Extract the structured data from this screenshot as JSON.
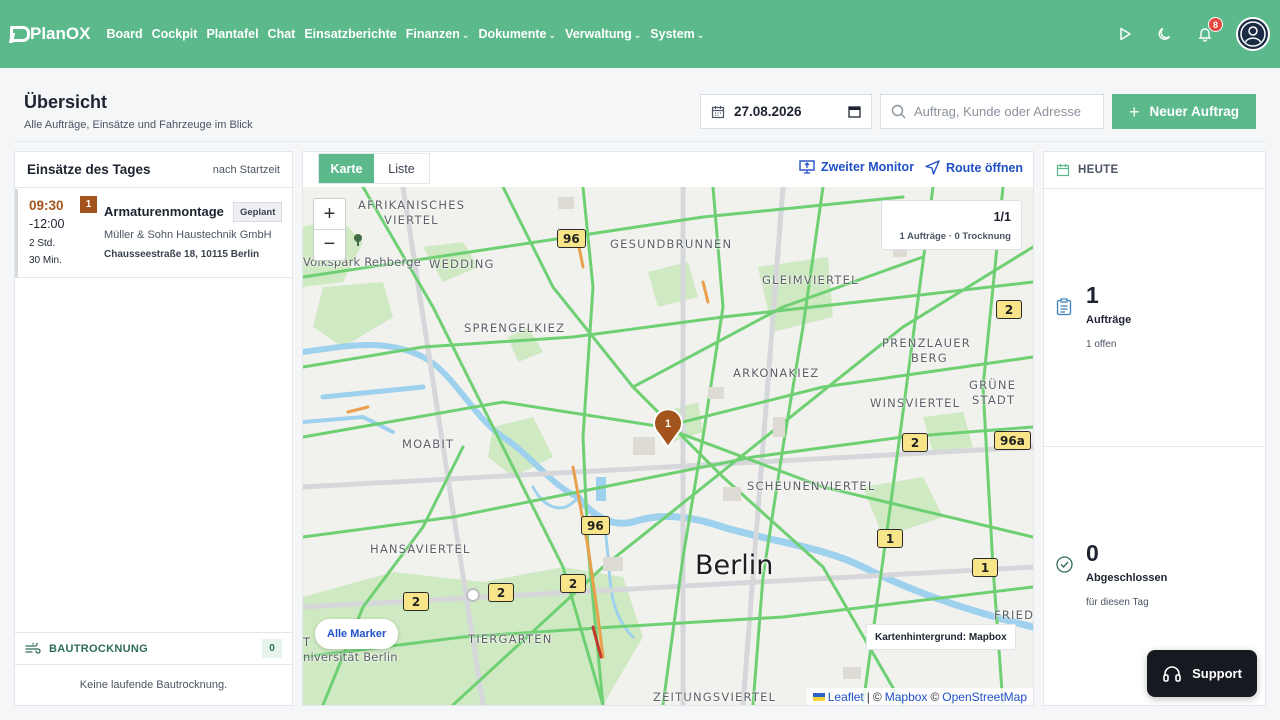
{
  "brand": {
    "name": "PlanOX",
    "color": "#5bb98c"
  },
  "nav": [
    {
      "label": "Board",
      "dropdown": false
    },
    {
      "label": "Cockpit",
      "dropdown": false,
      "active": true
    },
    {
      "label": "Plantafel",
      "dropdown": false
    },
    {
      "label": "Chat",
      "dropdown": false
    },
    {
      "label": "Einsatzberichte",
      "dropdown": false
    },
    {
      "label": "Finanzen",
      "dropdown": true
    },
    {
      "label": "Dokumente",
      "dropdown": true
    },
    {
      "label": "Verwaltung",
      "dropdown": true
    },
    {
      "label": "System",
      "dropdown": true
    }
  ],
  "topbar": {
    "notification_count": "8",
    "icons": [
      "play-icon",
      "moon-icon",
      "bell-icon",
      "user-avatar-icon"
    ]
  },
  "header": {
    "title": "Übersicht",
    "subtitle": "Alle Aufträge, Einsätze und Fahrzeuge im Blick",
    "date_value": "27.08.2026",
    "search_placeholder": "Auftrag, Kunde oder Adresse",
    "new_button": "Neuer Auftrag"
  },
  "left_panel": {
    "title": "Einsätze des Tages",
    "sort_label": "nach Startzeit",
    "jobs": [
      {
        "start": "09:30",
        "end": "-12:00",
        "duration_hours": "2 Std.",
        "duration_minutes": "30 Min.",
        "number": "1",
        "title": "Armaturenmontage",
        "status": "Geplant",
        "client": "Müller & Sohn Haustechnik GmbH",
        "address": "Chausseestraße 18, 10115 Berlin"
      }
    ],
    "bautrocknung": {
      "title": "BAUTROCKNUNG",
      "count": "0",
      "empty_text": "Keine laufende Bautrocknung."
    }
  },
  "map": {
    "tabs": [
      {
        "label": "Karte",
        "active": true
      },
      {
        "label": "Liste",
        "active": false
      }
    ],
    "actions": {
      "second_monitor": "Zweiter Monitor",
      "open_route": "Route öffnen"
    },
    "zoom_in": "+",
    "zoom_out": "−",
    "counter": {
      "ratio": "1/1",
      "detail": "1 Aufträge · 0 Trocknung"
    },
    "pin_number": "1",
    "city": "Berlin",
    "district_labels": {
      "afrikanisches": "AFRIKANISCHES",
      "viertel": "VIERTEL",
      "wedding": "WEDDING",
      "gesundbrunnen": "GESUNDBRUNNEN",
      "gleimviertel": "GLEIMVIERTEL",
      "sprengelkiez": "SPRENGELKIEZ",
      "prenzlauer": "PRENZLAUER",
      "berg": "BERG",
      "arkonakiez": "ARKONAKIEZ",
      "winsviertel": "WINSVIERTEL",
      "gruene": "GRÜNE",
      "stadt": "STADT",
      "moabit": "MOABIT",
      "scheunenviertel": "SCHEUNENVIERTEL",
      "hansaviertel": "HANSAVIERTEL",
      "tiergarten": "TIERGARTEN",
      "fried": "FRIED",
      "zeitungsviertel": "ZEITUNGSVIERTEL",
      "volkspark": "Volkspark Rehberge",
      "universitaet": "niversität Berlin",
      "t_edge": "T"
    },
    "route_badges": [
      "96",
      "2",
      "2",
      "96a",
      "96",
      "1",
      "2",
      "2",
      "1",
      "2"
    ],
    "all_markers": "Alle Marker",
    "background_label": "Kartenhintergrund: Mapbox",
    "attribution": {
      "leaflet": "Leaflet",
      "sep": "|",
      "copyright": "©",
      "mapbox": "Mapbox",
      "osm": "OpenStreetMap"
    },
    "colors": {
      "pin": "#a3541c",
      "road_green": "#67cc6b",
      "park": "#cce8c0",
      "water": "#9ed1ee"
    }
  },
  "right_panel": {
    "heading": "HEUTE",
    "stats": [
      {
        "value": "1",
        "label": "Aufträge",
        "sub": "1 offen",
        "icon": "clipboard-icon"
      },
      {
        "value": "0",
        "label": "Abgeschlossen",
        "sub": "für diesen Tag",
        "icon": "check-circle-icon"
      }
    ]
  },
  "support": {
    "label": "Support"
  }
}
